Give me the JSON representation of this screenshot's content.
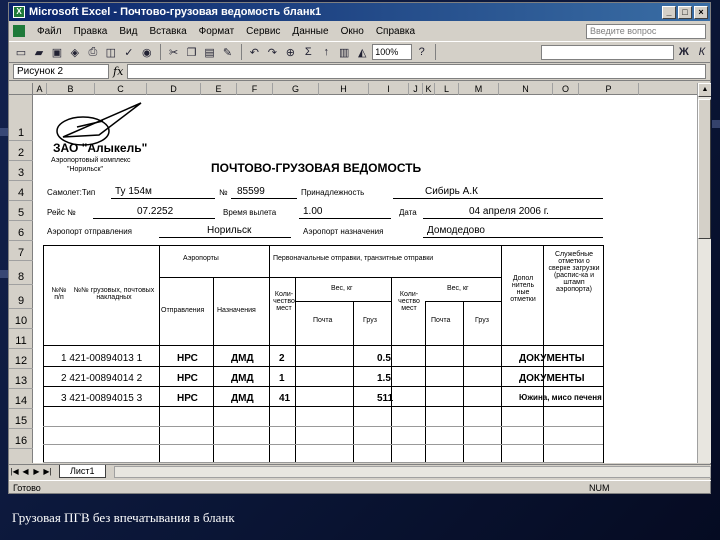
{
  "window": {
    "app_name": "Microsoft Excel",
    "title": "Microsoft Excel - Почтово-грузовая ведомость бланк1",
    "controls": {
      "minimize": "_",
      "maximize": "□",
      "close": "×"
    }
  },
  "menubar": {
    "items": [
      {
        "label": "Файл"
      },
      {
        "label": "Правка"
      },
      {
        "label": "Вид"
      },
      {
        "label": "Вставка"
      },
      {
        "label": "Формат"
      },
      {
        "label": "Сервис"
      },
      {
        "label": "Данные"
      },
      {
        "label": "Окно"
      },
      {
        "label": "Справка"
      }
    ],
    "help_placeholder": "Введите вопрос"
  },
  "toolbar": {
    "zoom": "100%",
    "font_bold": "Ж",
    "font_italic": "К"
  },
  "formula_bar": {
    "name_box": "Рисунок 2",
    "fx": "fx"
  },
  "columns": [
    "A",
    "B",
    "C",
    "D",
    "E",
    "F",
    "G",
    "H",
    "I",
    "J",
    "K",
    "L",
    "M",
    "N",
    "O",
    "P"
  ],
  "rows": [
    "1",
    "2",
    "3",
    "4",
    "5",
    "6",
    "7",
    "8",
    "9",
    "10",
    "11",
    "12",
    "13",
    "14",
    "15",
    "16"
  ],
  "document": {
    "company": "ЗАО \"Алыкель\"",
    "company_sub1": "Аэропортовый комплекс",
    "company_sub2": "\"Норильск\"",
    "heading": "ПОЧТОВО-ГРУЗОВАЯ ВЕДОМОСТЬ",
    "fields": {
      "aircraft_type_label": "Самолет:Тип",
      "aircraft_type_value": "Ту 154м",
      "number_label": "№",
      "number_value": "85599",
      "belonging_label": "Принадлежность",
      "belonging_value": "Сибирь А.К",
      "flight_label": "Рейс №",
      "flight_value": "07.2252",
      "departure_time_label": "Время вылета",
      "departure_time_value": "1.00",
      "date_label": "Дата",
      "date_value": "04 апреля 2006 г.",
      "departure_airport_label": "Аэропорт отправления",
      "departure_airport_value": "Норильск",
      "destination_airport_label": "Аэропорт назначения",
      "destination_airport_value": "Домодедово"
    },
    "table_headers": {
      "num": "№№ п/п",
      "waybills": "№№ грузовых, почтовых накладных",
      "airports": "Аэропорты",
      "origin": "Отправления",
      "destination": "Назначения",
      "transit_group": "Первоначальные отправки, транзитные отправки",
      "count": "Коли-чество мест",
      "weight": "Вес, кг",
      "mail": "Почта",
      "cargo": "Груз",
      "count2": "Коли-чество мест",
      "weight2": "Вес, кг",
      "mail2": "Почта",
      "cargo2": "Груз",
      "extra": "Допол нитель ные отметки",
      "service": "Служебные отметки о сверке загрузки (распис-ка и штамп аэропорта)"
    },
    "table_rows": [
      {
        "waybill": "1 421-00894013 1",
        "origin": "НРС",
        "dest": "ДМД",
        "count": "2",
        "cargo": "0.5",
        "note": "ДОКУМЕНТЫ"
      },
      {
        "waybill": "2 421-00894014 2",
        "origin": "НРС",
        "dest": "ДМД",
        "count": "1",
        "cargo": "1.5",
        "note": "ДОКУМЕНТЫ"
      },
      {
        "waybill": "3 421-00894015 3",
        "origin": "НРС",
        "dest": "ДМД",
        "count": "41",
        "cargo": "511",
        "note": "Южина, мисо печеня"
      }
    ]
  },
  "sheet_tabs": [
    {
      "label": "Лист1"
    }
  ],
  "statusbar": {
    "left": "Готово",
    "right": "NUM"
  },
  "caption": "Грузовая ПГВ без впечатывания в бланк"
}
